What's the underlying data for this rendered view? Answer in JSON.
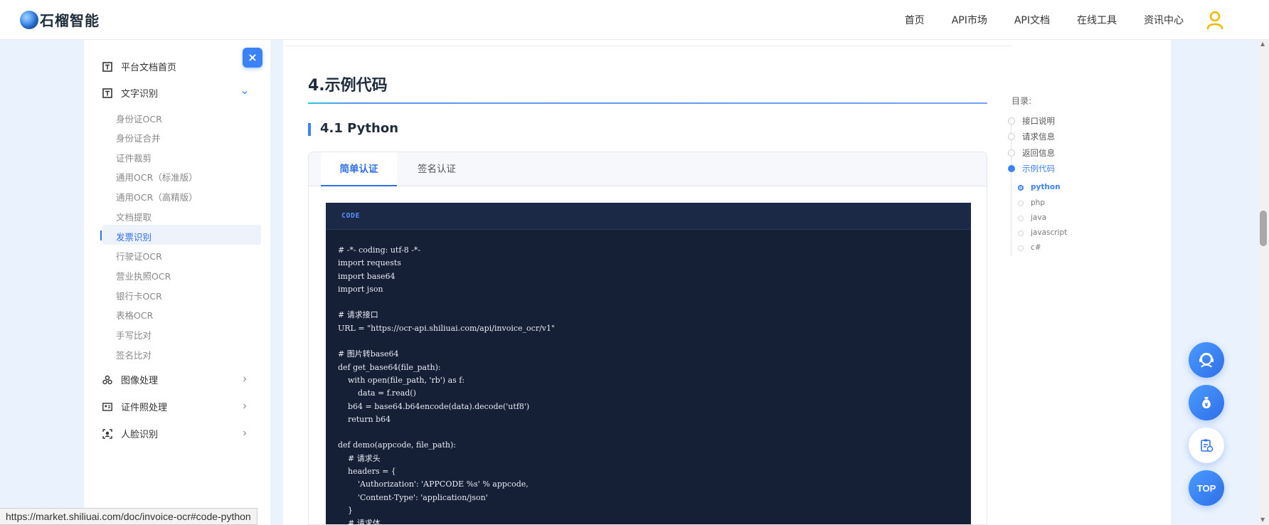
{
  "header": {
    "logo_text": "石榴智能",
    "nav": [
      "首页",
      "API市场",
      "API文档",
      "在线工具",
      "资讯中心"
    ]
  },
  "sidebar": {
    "close_label": "×",
    "groups": [
      {
        "label": "平台文档首页",
        "icon": "text-box-icon"
      },
      {
        "label": "文字识别",
        "icon": "text-box-icon",
        "expanded": true
      },
      {
        "label": "图像处理",
        "icon": "image-process-icon"
      },
      {
        "label": "证件照处理",
        "icon": "id-photo-icon"
      },
      {
        "label": "人脸识别",
        "icon": "face-scan-icon"
      }
    ],
    "sub_items": [
      "身份证OCR",
      "身份证合并",
      "证件裁剪",
      "通用OCR（标准版）",
      "通用OCR（高精版）",
      "文档提取",
      "发票识别",
      "行驶证OCR",
      "营业执照OCR",
      "银行卡OCR",
      "表格OCR",
      "手写比对",
      "签名比对"
    ],
    "active_sub": "发票识别"
  },
  "content": {
    "section_title": "4.示例代码",
    "subsection_title": "4.1 Python",
    "tabs": [
      "简单认证",
      "签名认证"
    ],
    "active_tab": "简单认证",
    "code_tag": "CODE",
    "code_lines": [
      "# -*- coding: utf-8 -*-",
      "import requests",
      "import base64",
      "import json",
      "",
      "# 请求接口",
      "URL = \"https://ocr-api.shiliuai.com/api/invoice_ocr/v1\"",
      "",
      "# 图片转base64",
      "def get_base64(file_path):",
      "    with open(file_path, 'rb') as f:",
      "        data = f.read()",
      "    b64 = base64.b64encode(data).decode('utf8')",
      "    return b64",
      "",
      "def demo(appcode, file_path):",
      "    # 请求头",
      "    headers = {",
      "        'Authorization': 'APPCODE %s' % appcode,",
      "        'Content-Type': 'application/json'",
      "    }",
      "    # 请求体"
    ]
  },
  "toc": {
    "title": "目录:",
    "items": [
      "接口说明",
      "请求信息",
      "返回信息",
      "示例代码"
    ],
    "active_item": "示例代码",
    "sub_items": [
      "python",
      "php",
      "java",
      "javascript",
      "c#"
    ],
    "active_sub": "python"
  },
  "float_buttons": {
    "top_label": "TOP"
  },
  "status_url": "https://market.shiliuai.com/doc/invoice-ocr#code-python",
  "colors": {
    "accent": "#3b82f6",
    "code_bg": "#151f35",
    "page_bg": "#eaf2fd",
    "user_icon": "#f5b800"
  }
}
